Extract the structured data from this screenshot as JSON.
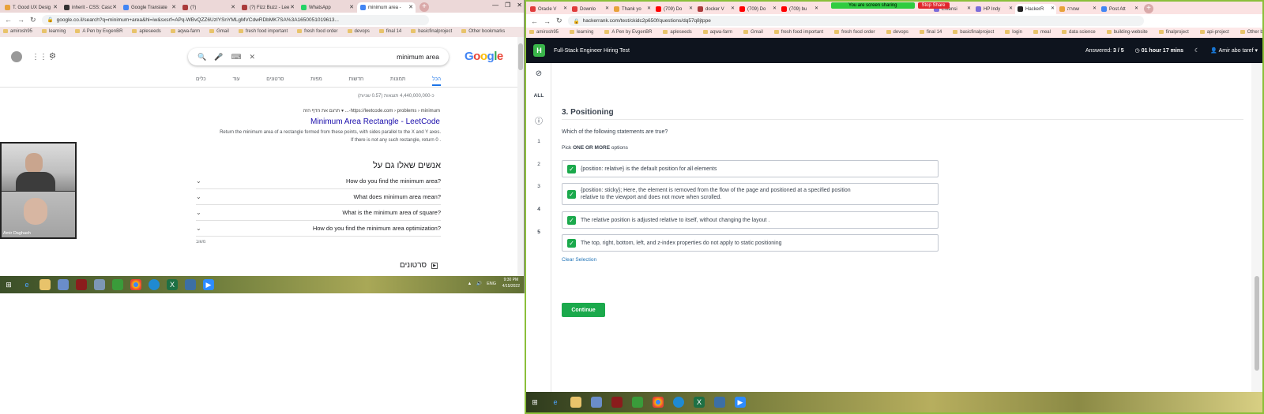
{
  "left": {
    "tabs": [
      {
        "label": "T. Good UX Desig",
        "color": "#e8a23a"
      },
      {
        "label": "inherit - CSS: Casc",
        "color": "#333333"
      },
      {
        "label": "Google Translate",
        "color": "#4285f4"
      },
      {
        "label": "(?)",
        "color": "#aa3b3b"
      },
      {
        "label": "(?) Fizz Buzz - Lee",
        "color": "#aa3b3b"
      },
      {
        "label": "WhatsApp",
        "color": "#25d366"
      },
      {
        "label": "minimum area - ",
        "color": "#4285f4"
      }
    ],
    "url": "google.co.il/search?q=minimum+area&hl=iw&sxsrf=APq-WBvQZZ6UzIYSnYMLgMVCdwRDbMK7SA%3A1650051019613...",
    "bookmarks": [
      "amirosh95",
      "learning",
      "A Pen by EvgenBR",
      "apleseeds",
      "aqwa-farm",
      "Gmail",
      "fresh food important",
      "fresh food order",
      "devops",
      "final 14",
      "basicfinalproject",
      "Other bookmarks"
    ],
    "search_value": "minimum area",
    "logo": "Google",
    "search_tabs": [
      "הכל",
      "תמונות",
      "חדשות",
      "מפות",
      "סרטונים",
      "עוד",
      "כלים"
    ],
    "result_count": "כ-4,440,000,000 תוצאות (0.57 שניות)",
    "result_cite": "https://leetcode.com › problems › minimum-... ▾ תרגם את הדף הזה",
    "result_title": "Minimum Area Rectangle - LeetCode",
    "result_snippet": "Return the minimum area of a rectangle formed from these points, with sides parallel to the X and Y axes. If there is not any such rectangle, return 0 .",
    "paa_title": "אנשים שאלו גם על",
    "paa": [
      "How do you find the minimum area?",
      "What does minimum area mean?",
      "What is the minimum area of square?",
      "How do you find the minimum area optimization?"
    ],
    "feedback": "משוב",
    "videos_title": "סרטונים",
    "call_name": "Amir Daghash",
    "taskbar_lang": "ENG",
    "taskbar_time": "9:30 PM",
    "taskbar_date": "4/15/2022"
  },
  "right": {
    "tabs": [
      {
        "label": "Oracle V",
        "color": "#e03b3b"
      },
      {
        "label": "Downlo",
        "color": "#e03b3b"
      },
      {
        "label": "Thank yo",
        "color": "#e8a23a"
      },
      {
        "label": "(709) Do",
        "color": "#ff0000"
      },
      {
        "label": "docker V",
        "color": "#aa3b3b"
      },
      {
        "label": "(709) Do",
        "color": "#ff0000"
      },
      {
        "label": "(709) bu",
        "color": "#ff0000"
      },
      {
        "label": "Extensi",
        "color": "#7b6cd9"
      },
      {
        "label": "HP Indy",
        "color": "#7b6cd9"
      },
      {
        "label": "HackerR",
        "color": "#222222"
      },
      {
        "label": "שמרה",
        "color": "#e8a23a"
      },
      {
        "label": "Post Att",
        "color": "#4285f4"
      }
    ],
    "sharing_text": "You are screen sharing",
    "stop_share": "Stop Share",
    "url": "hackerrank.com/test/ckidc2p650f/questions/dq57q8jtppe",
    "bookmarks": [
      "amirosh95",
      "learning",
      "A Pen by EvgenBR",
      "apleseeds",
      "aqwa-farm",
      "Gmail",
      "fresh food important",
      "fresh food order",
      "devops",
      "final 14",
      "basicfinalproject",
      "login",
      "meal",
      "data science",
      "building-website",
      "finalproject",
      "api-project",
      "Other bookmarks"
    ],
    "header": {
      "logo": "H",
      "title": "Full-Stack Engineer Hiring Test",
      "answered_label": "Answered:",
      "answered_value": "3 / 5",
      "timer": "01 hour 17 mins",
      "user": "Amir abo taref"
    },
    "sidebar": {
      "all": "ALL",
      "items": [
        "1",
        "2",
        "3",
        "4",
        "5"
      ]
    },
    "question": {
      "title": "3. Positioning",
      "text": "Which of the following statements are true?",
      "pick_prefix": "Pick ",
      "pick_bold": "ONE OR MORE",
      "pick_suffix": " options",
      "options": [
        {
          "line1": "{position: relative} is the default position for all elements",
          "line2": ""
        },
        {
          "line1": "{position: sticky}; Here, the element is removed from the flow of the page and positioned at a specified position",
          "line2": "relative to the viewport and does not move when scrolled."
        },
        {
          "line1": "The relative position is adjusted relative to itself, without changing the layout .",
          "line2": ""
        },
        {
          "line1": "The top, right, bottom, left, and z-index properties do not apply to static positioning",
          "line2": ""
        }
      ],
      "clear_label": "Clear Selection",
      "continue_label": "Continue"
    }
  },
  "colors": {
    "hr_green": "#1ba94c",
    "hr_dark": "#0e141e",
    "google_blue": "#1a0dab",
    "tab_pink": "#ecd8d8"
  }
}
